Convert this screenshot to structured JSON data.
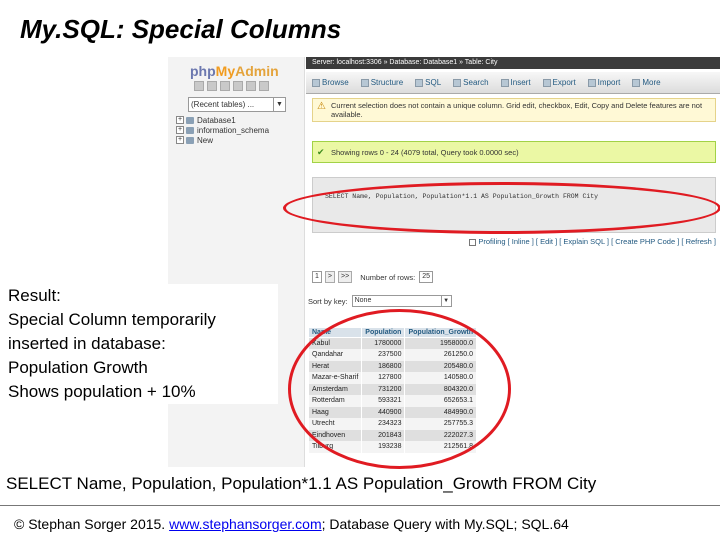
{
  "slide": {
    "title": "My.SQL: Special Columns",
    "result_lines": [
      "Result:",
      "Special Column temporarily",
      "inserted in database:",
      "Population Growth",
      "Shows population + 10%"
    ],
    "sql_caption": "SELECT Name, Population, Population*1.1 AS Population_Growth FROM City",
    "footer": {
      "prefix": "© Stephan Sorger 2015. ",
      "link": "www.stephansorger.com",
      "suffix": "; Database Query with My.SQL; SQL.64"
    }
  },
  "pma": {
    "logo": {
      "php": "php",
      "my": "My",
      "admin": "Admin"
    },
    "recent_placeholder": "(Recent tables) ...",
    "databases": [
      "Database1",
      "information_schema",
      "New"
    ],
    "breadcrumb": "Server: localhost:3306 » Database: Database1 » Table: City",
    "tabs": [
      "Browse",
      "Structure",
      "SQL",
      "Search",
      "Insert",
      "Export",
      "Import",
      "More"
    ],
    "warning": "Current selection does not contain a unique column. Grid edit, checkbox, Edit, Copy and Delete features are not available.",
    "success": "Showing rows 0 - 24 (4079 total, Query took 0.0000 sec)",
    "sql_query": "SELECT Name, Population, Population*1.1 AS Population_Growth FROM City",
    "profiling": "Profiling [ Inline ] [ Edit ] [ Explain SQL ] [ Create PHP Code ] [ Refresh ]",
    "nav": {
      "page": "1",
      "rows_label": "Number of rows:",
      "rows_value": "25"
    },
    "sort": {
      "label": "Sort by key:",
      "value": "None"
    },
    "table": {
      "columns": [
        "Name",
        "Population",
        "Population_Growth"
      ],
      "rows": [
        [
          "Kabul",
          "1780000",
          "1958000.0"
        ],
        [
          "Qandahar",
          "237500",
          "261250.0"
        ],
        [
          "Herat",
          "186800",
          "205480.0"
        ],
        [
          "Mazar-e-Sharif",
          "127800",
          "140580.0"
        ],
        [
          "Amsterdam",
          "731200",
          "804320.0"
        ],
        [
          "Rotterdam",
          "593321",
          "652653.1"
        ],
        [
          "Haag",
          "440900",
          "484990.0"
        ],
        [
          "Utrecht",
          "234323",
          "257755.3"
        ],
        [
          "Eindhoven",
          "201843",
          "222027.3"
        ],
        [
          "Tilburg",
          "193238",
          "212561.8"
        ]
      ]
    }
  }
}
